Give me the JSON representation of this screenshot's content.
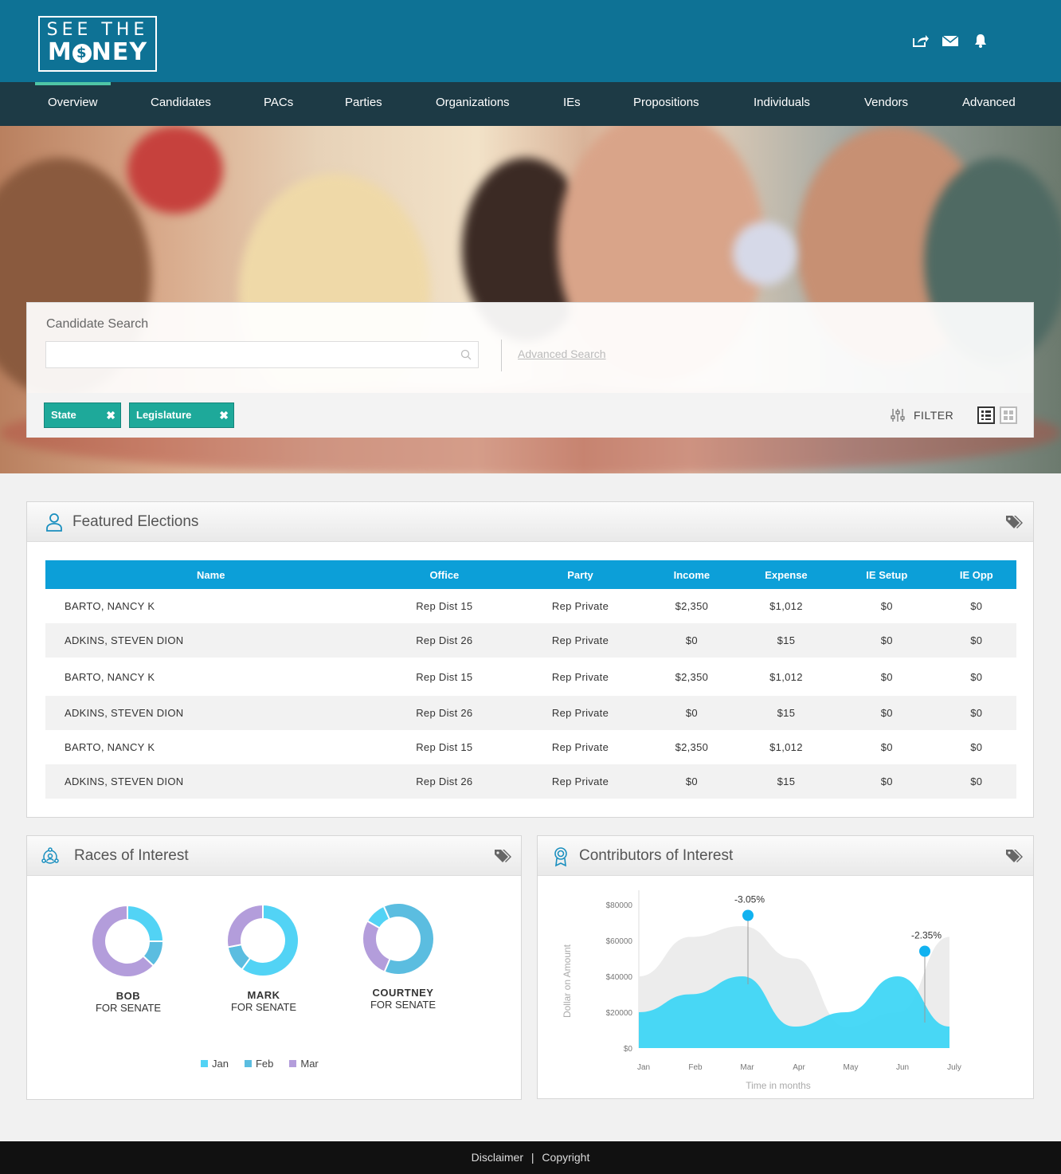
{
  "header": {
    "logo_line1": "SEE THE",
    "logo_line2_a": "M",
    "logo_dollar": "$",
    "logo_line2_b": "NEY",
    "icons": [
      "share-icon",
      "mail-icon",
      "bell-icon"
    ]
  },
  "nav": {
    "items": [
      "Overview",
      "Candidates",
      "PACs",
      "Parties",
      "Organizations",
      "IEs",
      "Propositions",
      "Individuals",
      "Vendors",
      "Advanced"
    ],
    "active": "Overview"
  },
  "search": {
    "title": "Candidate Search",
    "value": "",
    "placeholder": "",
    "advanced_link": "Advanced Search",
    "chips": [
      "State",
      "Legislature"
    ],
    "filter_label": "FILTER"
  },
  "featured": {
    "title": "Featured Elections",
    "columns": [
      "Name",
      "Office",
      "Party",
      "Income",
      "Expense",
      "IE Setup",
      "IE Opp"
    ],
    "rows": [
      [
        "BARTO, NANCY K",
        "Rep Dist 15",
        "Rep Private",
        "$2,350",
        "$1,012",
        "$0",
        "$0"
      ],
      [
        "ADKINS, STEVEN DION",
        "Rep Dist 26",
        "Rep Private",
        "$0",
        "$15",
        "$0",
        "$0"
      ],
      [
        "BARTO, NANCY K",
        "Rep Dist 15",
        "Rep Private",
        "$2,350",
        "$1,012",
        "$0",
        "$0"
      ],
      [
        "ADKINS, STEVEN DION",
        "Rep Dist 26",
        "Rep Private",
        "$0",
        "$15",
        "$0",
        "$0"
      ],
      [
        "BARTO, NANCY K",
        "Rep Dist 15",
        "Rep Private",
        "$2,350",
        "$1,012",
        "$0",
        "$0"
      ],
      [
        "ADKINS, STEVEN DION",
        "Rep Dist 26",
        "Rep Private",
        "$0",
        "$15",
        "$0",
        "$0"
      ]
    ]
  },
  "races": {
    "title": "Races of Interest",
    "donuts": [
      {
        "name": "BOB",
        "subtitle": "FOR SENATE"
      },
      {
        "name": "MARK",
        "subtitle": "FOR SENATE"
      },
      {
        "name": "COURTNEY",
        "subtitle": "FOR SENATE"
      }
    ],
    "legend": [
      "Jan",
      "Feb",
      "Mar"
    ],
    "colors": {
      "Jan": "#52d3f5",
      "Feb": "#5bbde0",
      "Mar": "#b39ddb"
    }
  },
  "contributors": {
    "title": "Contributors of Interest",
    "ylabel": "Dollar on Amount",
    "xlabel": "Time in months",
    "y_ticks": [
      "$80000",
      "$60000",
      "$40000",
      "$20000",
      "$0"
    ],
    "x_ticks": [
      "Jan",
      "Feb",
      "Mar",
      "Apr",
      "May",
      "Jun",
      "July"
    ],
    "annotations": [
      "-3.05%",
      "-2.35%"
    ]
  },
  "chart_data": [
    {
      "type": "pie",
      "title": "BOB FOR SENATE",
      "categories": [
        "Jan",
        "Feb",
        "Mar"
      ],
      "values": [
        25,
        12,
        63
      ]
    },
    {
      "type": "pie",
      "title": "MARK FOR SENATE",
      "categories": [
        "Jan",
        "Feb",
        "Mar"
      ],
      "values": [
        60,
        12,
        28
      ]
    },
    {
      "type": "pie",
      "title": "COURTNEY FOR SENATE",
      "categories": [
        "Jan",
        "Feb",
        "Mar"
      ],
      "values": [
        10,
        63,
        27
      ]
    },
    {
      "type": "area",
      "title": "Contributors of Interest",
      "xlabel": "Time in months",
      "ylabel": "Dollar on Amount",
      "categories": [
        "Jan",
        "Feb",
        "Mar",
        "Apr",
        "May",
        "Jun",
        "July"
      ],
      "ylim": [
        0,
        80000
      ],
      "series": [
        {
          "values": [
            40000,
            62000,
            68000,
            50000,
            12000,
            20000,
            62000
          ]
        },
        {
          "values": [
            20000,
            30000,
            40000,
            12000,
            20000,
            40000,
            12000
          ]
        }
      ],
      "annotations": [
        {
          "x": "Mar",
          "y": 74000,
          "text": "-3.05%"
        },
        {
          "x": "Jun",
          "y": 54000,
          "text": "-2.35%"
        }
      ]
    }
  ],
  "footer": {
    "disclaimer": "Disclaimer",
    "separator": "|",
    "copyright": "Copyright"
  }
}
